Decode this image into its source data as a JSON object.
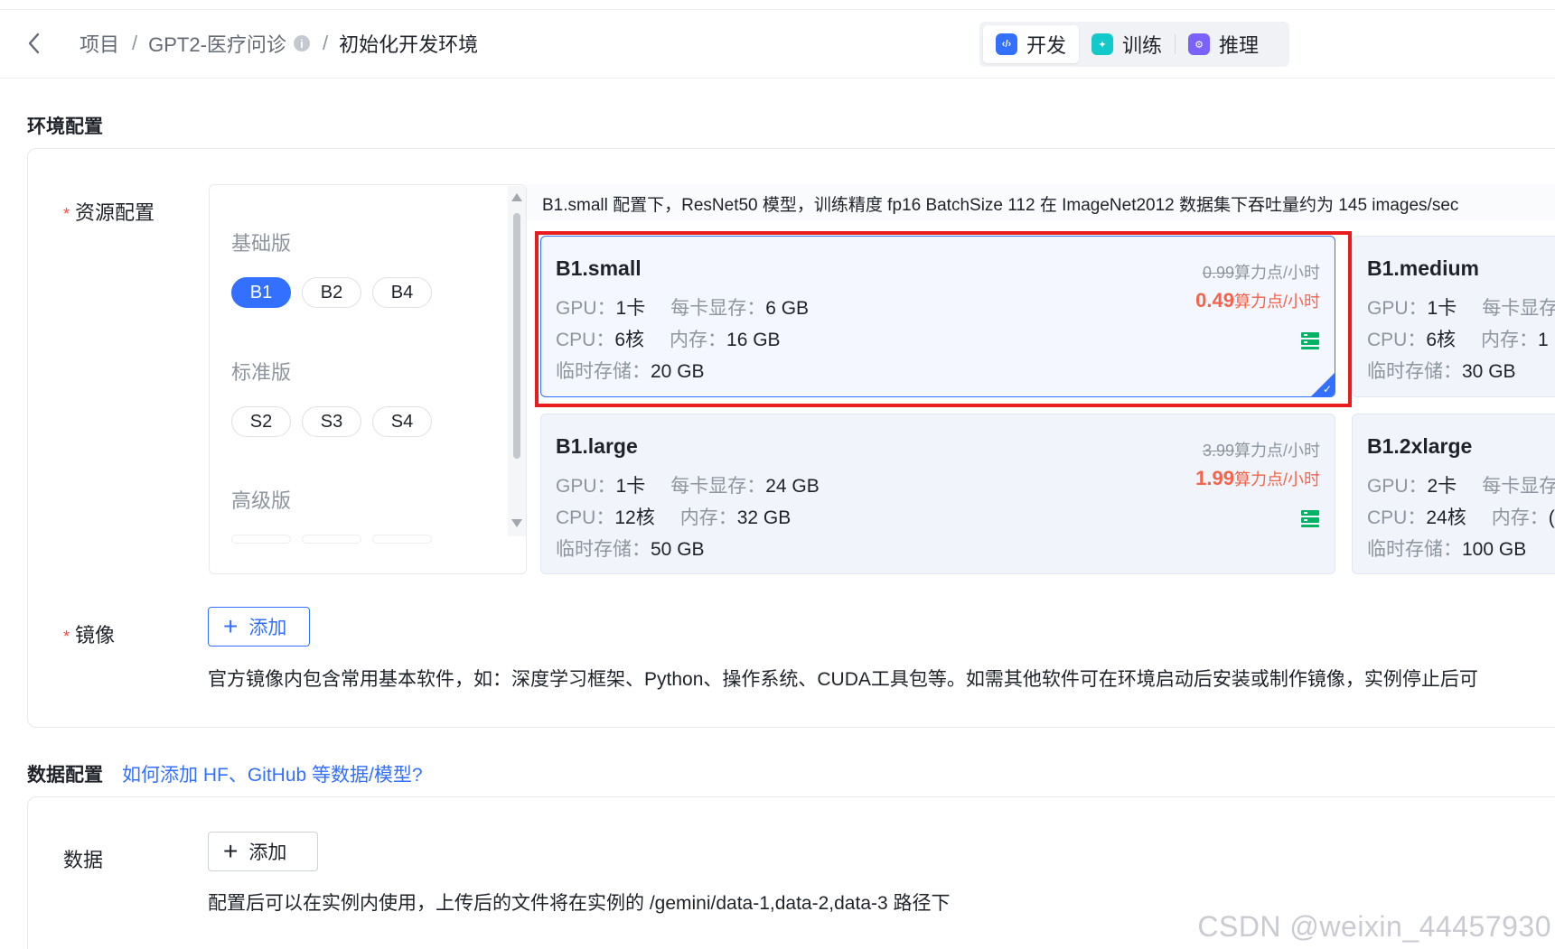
{
  "header": {
    "breadcrumb": [
      "项目",
      "GPT2-医疗问诊",
      "初始化开发环境"
    ],
    "separator": "/",
    "info_icon_glyph": "i",
    "modes": [
      {
        "label": "开发",
        "icon": "code-icon",
        "color": "#3370ff",
        "glyph": "‹/›"
      },
      {
        "label": "训练",
        "icon": "train-icon",
        "color": "#14c9c9",
        "glyph": "✦"
      },
      {
        "label": "推理",
        "icon": "inference-icon",
        "color": "#7b61ff",
        "glyph": "⚙"
      }
    ]
  },
  "env": {
    "title": "环境配置",
    "resource_label": "资源配置",
    "required_mark": "*",
    "groups": [
      {
        "name": "基础版",
        "chips": [
          "B1",
          "B2",
          "B4"
        ],
        "active": "B1"
      },
      {
        "name": "标准版",
        "chips": [
          "S2",
          "S3",
          "S4"
        ]
      },
      {
        "name": "高级版",
        "chips": [
          "",
          "",
          ""
        ]
      }
    ],
    "spec_note": "B1.small 配置下，ResNet50 模型，训练精度 fp16 BatchSize 112 在 ImageNet2012 数据集下吞吐量约为 145 images/sec",
    "cards": [
      {
        "name": "B1.small",
        "gpu": "1卡",
        "vram": "6 GB",
        "cpu": "6核",
        "mem": "16 GB",
        "disk": "20 GB",
        "orig_price": "0.99",
        "price": "0.49",
        "unit": "算力点/小时",
        "selected": true
      },
      {
        "name": "B1.medium",
        "gpu": "1卡",
        "vram": "",
        "cpu": "6核",
        "mem": "1",
        "disk": "30 GB"
      },
      {
        "name": "B1.large",
        "gpu": "1卡",
        "vram": "24 GB",
        "cpu": "12核",
        "mem": "32 GB",
        "disk": "50 GB",
        "orig_price": "3.99",
        "price": "1.99",
        "unit": "算力点/小时"
      },
      {
        "name": "B1.2xlarge",
        "gpu": "2卡",
        "vram": "",
        "cpu": "24核",
        "mem": "(",
        "disk": "100 GB"
      }
    ],
    "labels": {
      "gpu": "GPU：",
      "vram": "每卡显存：",
      "vram_cut": "每卡显存",
      "cpu": "CPU：",
      "mem": "内存：",
      "disk": "临时存储："
    },
    "image_label": "镜像",
    "image_add": "添加",
    "image_hint": "官方镜像内包含常用基本软件，如：深度学习框架、Python、操作系统、CUDA工具包等。如需其他软件可在环境启动后安装或制作镜像，实例停止后可"
  },
  "data_section": {
    "title": "数据配置",
    "help_link": "如何添加 HF、GitHub 等数据/模型?",
    "data_label": "数据",
    "add": "添加",
    "hint": "配置后可以在实例内使用，上传后的文件将在实例的 /gemini/data-1,data-2,data-3 路径下"
  },
  "watermark": "CSDN @weixin_44457930",
  "colors": {
    "accent": "#3370ff",
    "price": "#f5634a",
    "highlight": "#e81c1c",
    "server_icon": "#00b365"
  }
}
